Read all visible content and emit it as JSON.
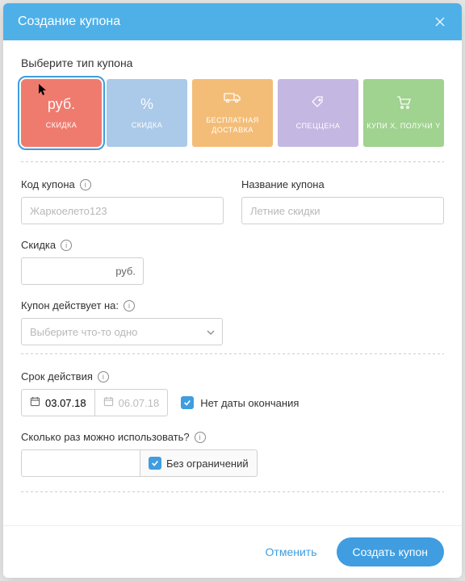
{
  "header": {
    "title": "Создание купона"
  },
  "select_type_label": "Выберите тип купона",
  "types": [
    {
      "icon": "руб.",
      "label": "СКИДКА"
    },
    {
      "icon": "%",
      "label": "СКИДКА"
    },
    {
      "icon": "truck",
      "label": "БЕСПЛАТНАЯ ДОСТАВКА"
    },
    {
      "icon": "tag",
      "label": "СПЕЦЦЕНА"
    },
    {
      "icon": "cart",
      "label": "КУПИ X, ПОЛУЧИ Y"
    }
  ],
  "code": {
    "label": "Код купона",
    "placeholder": "Жаркоелето123"
  },
  "name": {
    "label": "Название купона",
    "placeholder": "Летние скидки"
  },
  "discount": {
    "label": "Скидка",
    "suffix": "руб."
  },
  "applies": {
    "label": "Купон действует на:",
    "placeholder": "Выберите что-то одно"
  },
  "validity": {
    "label": "Срок действия",
    "start": "03.07.18",
    "end": "06.07.18",
    "no_end_label": "Нет даты окончания",
    "no_end_checked": true
  },
  "usage": {
    "label": "Сколько раз можно использовать?",
    "unlimited_label": "Без ограничений",
    "unlimited_checked": true
  },
  "footer": {
    "cancel": "Отменить",
    "create": "Создать купон"
  }
}
